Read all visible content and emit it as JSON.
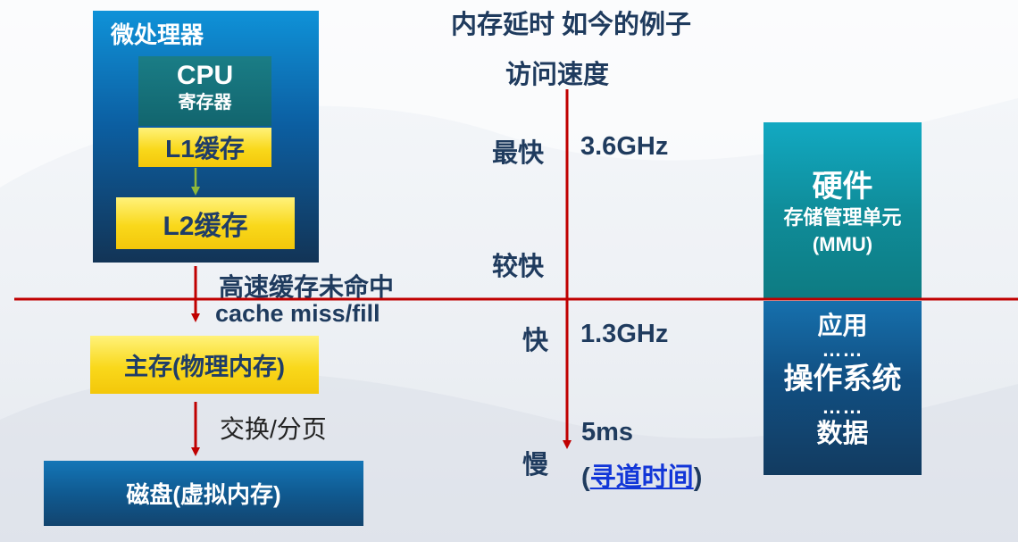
{
  "processor": {
    "title": "微处理器",
    "cpu_label": "CPU",
    "register_label": "寄存器",
    "l1_label": "L1缓存",
    "l2_label": "L2缓存"
  },
  "cache_miss": {
    "line1": "高速缓存未命中",
    "line2": "cache miss/fill"
  },
  "main_memory": "主存(物理内存)",
  "swap_label": "交换/分页",
  "disk": "磁盘(虚拟内存)",
  "header": {
    "line1": "内存延时  如今的例子",
    "line2": "访问速度"
  },
  "speeds": {
    "fastest": "最快",
    "faster": "较快",
    "fast": "快",
    "slow": "慢"
  },
  "examples": {
    "fastest": "3.6GHz",
    "fast": "1.3GHz",
    "slow": "5ms",
    "slow_paren_open": "(",
    "slow_link": "寻道时间",
    "slow_paren_close": ")"
  },
  "hardware": {
    "title": "硬件",
    "line2": "存储管理单元",
    "line3": "(MMU)"
  },
  "software": {
    "app": "应用",
    "dots1": "……",
    "os": "操作系统",
    "dots2": "……",
    "data": "数据"
  },
  "colors": {
    "divider": "#c00000",
    "arrow": "#c00000",
    "dark_text": "#1f3b5e",
    "yellow": "#f9d81b"
  }
}
